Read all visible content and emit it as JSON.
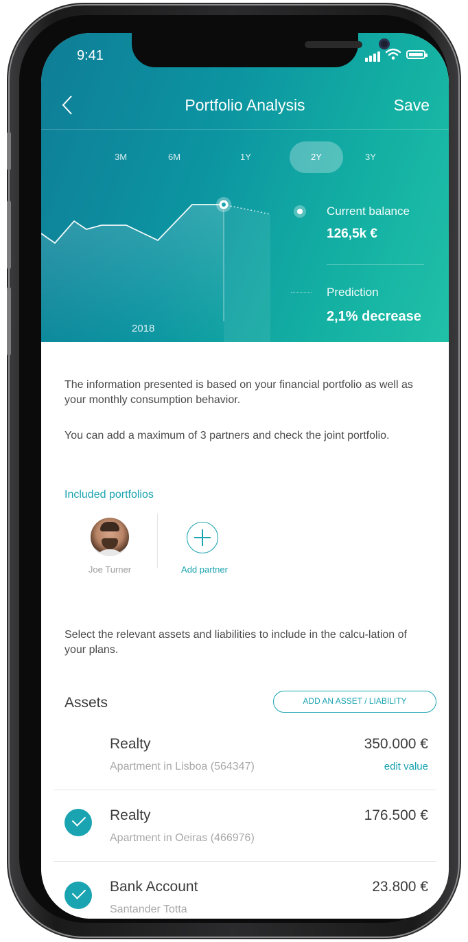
{
  "status_bar": {
    "time": "9:41"
  },
  "nav": {
    "title": "Portfolio Analysis",
    "save_label": "Save"
  },
  "tabs": [
    {
      "label": "3M",
      "active": false
    },
    {
      "label": "6M",
      "active": false
    },
    {
      "label": "1Y",
      "active": false
    },
    {
      "label": "2Y",
      "active": true
    },
    {
      "label": "3Y",
      "active": false
    }
  ],
  "chart": {
    "year_label": "2018"
  },
  "legend": {
    "current_label": "Current balance",
    "current_value": "126,5k €",
    "prediction_label": "Prediction",
    "prediction_value": "2,1% decrease"
  },
  "intro": {
    "p1": "The information presented is based on your financial portfolio as well as your monthly consumption behavior.",
    "p2": "You can add a maximum of 3 partners and check the joint portfolio."
  },
  "portfolios": {
    "title": "Included portfolios",
    "partner_name": "Joe Turner",
    "add_partner_label": "Add partner"
  },
  "select_text": "Select the relevant assets and liabilities to include in the calcu-lation of your plans.",
  "assets": {
    "title": "Assets",
    "add_button": "ADD AN ASSET / LIABILITY",
    "items": [
      {
        "title": "Realty",
        "subtitle": "Apartment in Lisboa (564347)",
        "value": "350.000 €",
        "edit": "edit value",
        "checked": false
      },
      {
        "title": "Realty",
        "subtitle": "Apartment in Oeiras (466976)",
        "value": "176.500 €",
        "checked": true
      },
      {
        "title": "Bank Account",
        "subtitle": "Santander Totta",
        "value": "23.800 €",
        "checked": true
      }
    ]
  },
  "colors": {
    "accent": "#1aa3b0",
    "hero_start": "#0f7d97",
    "hero_end": "#20c0a8"
  }
}
